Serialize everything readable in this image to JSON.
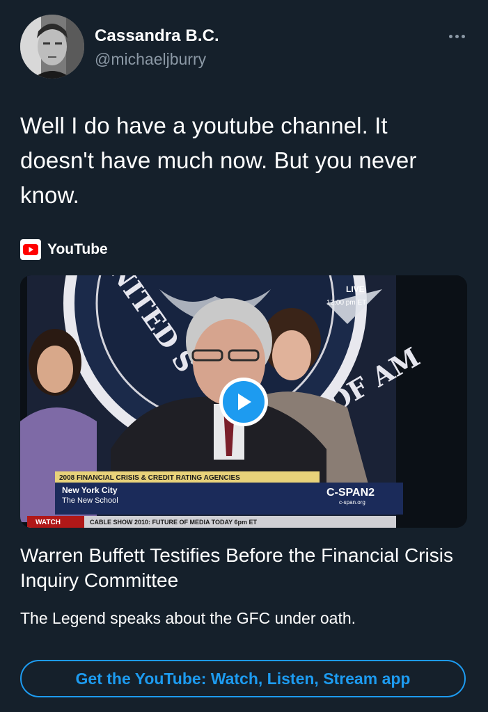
{
  "tweet": {
    "author": {
      "display_name": "Cassandra B.C.",
      "handle": "@michaeljburry",
      "avatar_icon": "profile-photo"
    },
    "more_icon": "more-horizontal-icon",
    "text": "Well I do have a youtube channel. It doesn't have much now. But you never know."
  },
  "card": {
    "source": {
      "icon": "youtube-logo-icon",
      "label": "YouTube"
    },
    "thumbnail": {
      "banner_topic": "2008 FINANCIAL CRISIS & CREDIT RATING AGENCIES",
      "location_line1": "New York City",
      "location_line2": "The New School",
      "network": "C-SPAN2",
      "network_url": "c-span.org",
      "live_label": "LIVE",
      "live_time": "12:00 pm ET",
      "ticker_watch": "WATCH",
      "ticker_text": "CABLE SHOW 2010: FUTURE OF MEDIA  TODAY 6pm ET",
      "seal_text_left": "NITED S",
      "seal_text_right": "OF AM"
    },
    "play_icon": "play-icon",
    "title": "Warren Buffett Testifies Before the Financial Crisis Inquiry Committee",
    "description": "The Legend speaks about the GFC under oath."
  },
  "cta": {
    "label": "Get the YouTube: Watch, Listen, Stream app"
  },
  "colors": {
    "background": "#15202b",
    "accent": "#1d9bf0",
    "secondary_text": "#8b98a5",
    "youtube_red": "#ff0000"
  }
}
